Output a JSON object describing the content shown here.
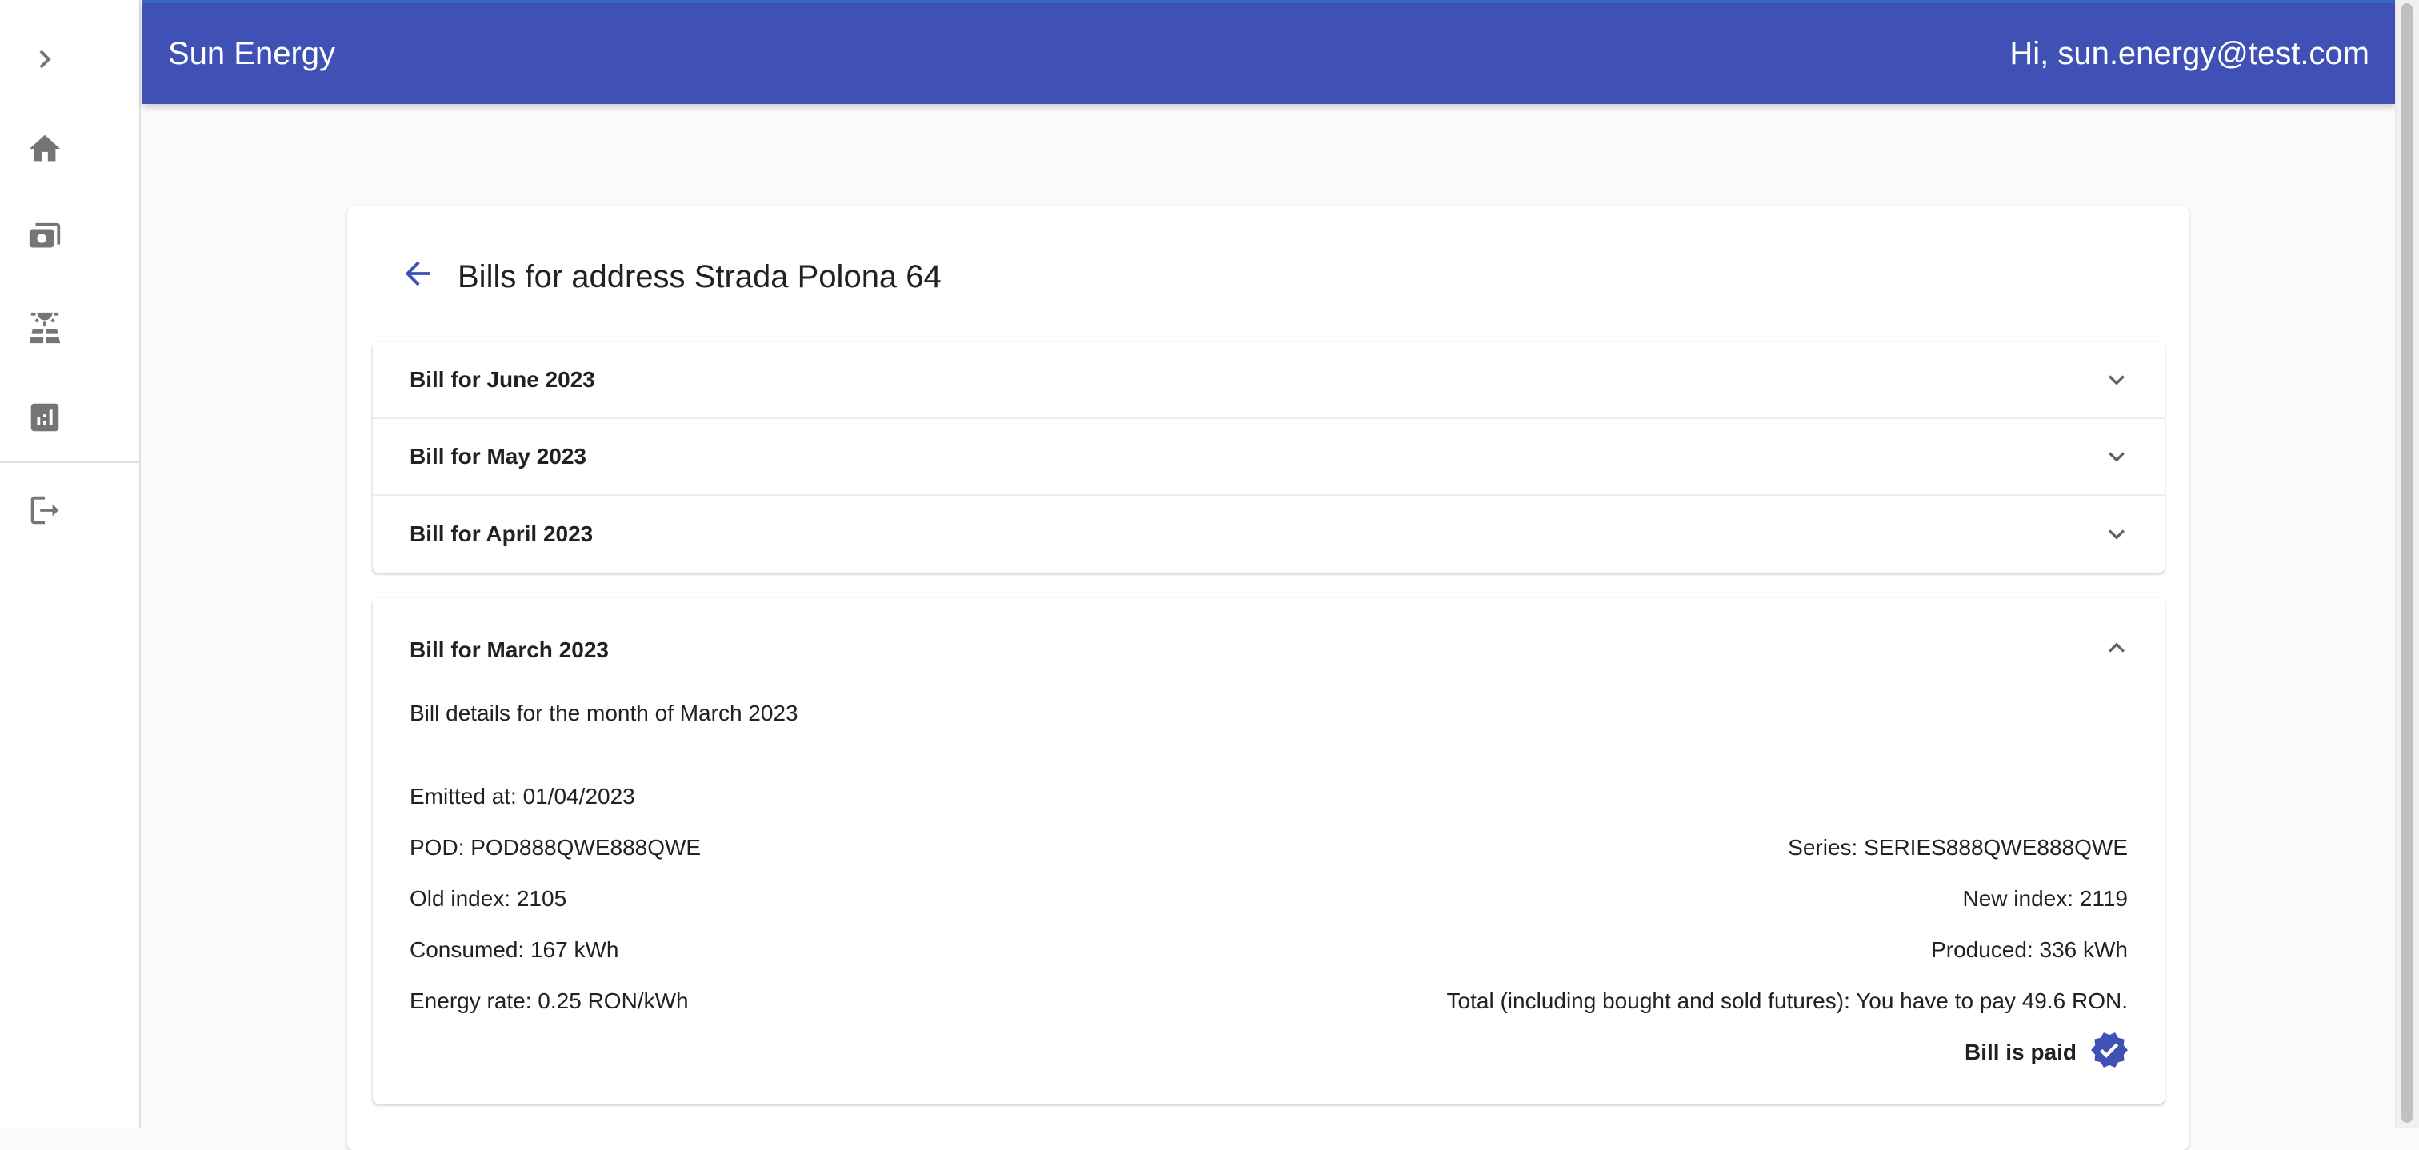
{
  "app": {
    "brand": "Sun Energy",
    "greeting": "Hi, sun.energy@test.com",
    "accent_color": "#3f51b5"
  },
  "sidebar": {
    "items": [
      {
        "icon": "chevron-right-icon"
      },
      {
        "icon": "home-icon"
      },
      {
        "icon": "bills-money-icon"
      },
      {
        "icon": "solar-panel-icon"
      },
      {
        "icon": "analytics-chart-icon"
      },
      {
        "icon": "logout-icon"
      }
    ]
  },
  "page": {
    "title": "Bills for address Strada Polona 64"
  },
  "bills": {
    "collapsed": [
      {
        "label": "Bill for June 2023"
      },
      {
        "label": "Bill for May 2023"
      },
      {
        "label": "Bill for April 2023"
      }
    ],
    "expanded": {
      "label": "Bill for March 2023",
      "description": "Bill details for the month of March 2023",
      "emitted": "Emitted at: 01/04/2023",
      "pod": "POD: POD888QWE888QWE",
      "series": "Series: SERIES888QWE888QWE",
      "old_index": "Old index: 2105",
      "new_index": "New index: 2119",
      "consumed": "Consumed: 167 kWh",
      "produced": "Produced: 336 kWh",
      "energy_rate": "Energy rate: 0.25 RON/kWh",
      "total": "Total (including bought and sold futures): You have to pay 49.6 RON.",
      "paid_status": "Bill is paid"
    }
  }
}
